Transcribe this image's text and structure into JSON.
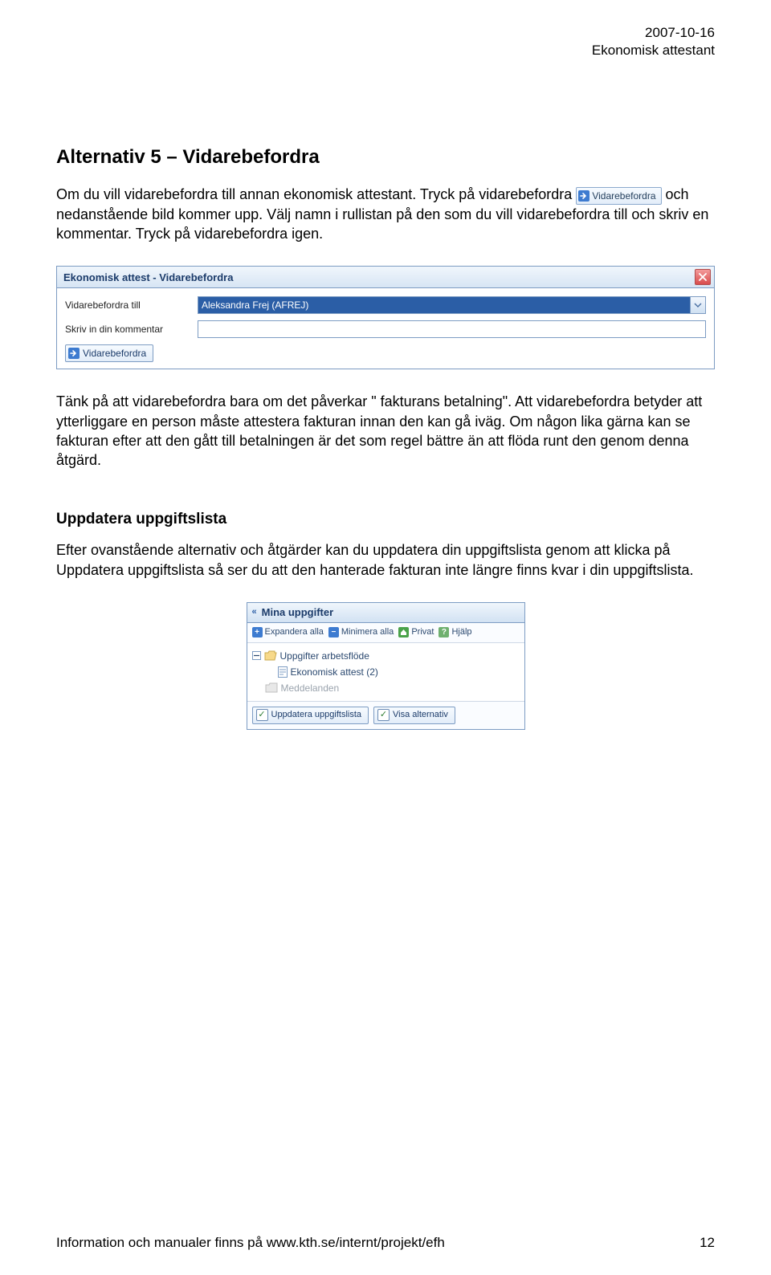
{
  "header": {
    "date": "2007-10-16",
    "role": "Ekonomisk attestant"
  },
  "section": {
    "heading": "Alternativ 5 – Vidarebefordra",
    "para1a": "Om du vill vidarebefordra till annan ekonomisk attestant. Tryck på vidarebefordra ",
    "inlineBtn": "Vidarebefordra",
    "para1b": " och nedanstående bild kommer upp. Välj namn i rullistan på den som du vill vidarebefordra till och skriv en kommentar. Tryck på vidarebefordra igen.",
    "para2": "Tänk på att vidarebefordra bara om det påverkar \" fakturans betalning\". Att vidarebefordra betyder att ytterliggare en person måste attestera fakturan innan den kan gå iväg. Om någon lika gärna kan se fakturan efter att den gått till betalningen är det som regel bättre än att flöda runt den genom denna åtgärd.",
    "subHeading": "Uppdatera uppgiftslista",
    "para3": "Efter ovanstående alternativ och åtgärder kan du uppdatera din uppgiftslista genom att klicka på Uppdatera uppgiftslista så ser du att den hanterade fakturan inte längre finns kvar i din uppgiftslista."
  },
  "dialog": {
    "title": "Ekonomisk attest - Vidarebefordra",
    "labelForwardTo": "Vidarebefordra till",
    "selectedPerson": "Aleksandra Frej (AFREJ)",
    "labelComment": "Skriv in din kommentar",
    "buttonLabel": "Vidarebefordra"
  },
  "sidePanel": {
    "title": "Mina uppgifter",
    "toolbar": {
      "expand": "Expandera alla",
      "minimize": "Minimera alla",
      "private": "Privat",
      "help": "Hjälp"
    },
    "tree": {
      "root": "Uppgifter arbetsflöde",
      "item1": "Ekonomisk attest (2)",
      "item2": "Meddelanden"
    },
    "bottom": {
      "update": "Uppdatera uppgiftslista",
      "showAlt": "Visa alternativ"
    }
  },
  "footer": {
    "left": "Information och manualer finns på www.kth.se/internt/projekt/efh",
    "page": "12"
  }
}
